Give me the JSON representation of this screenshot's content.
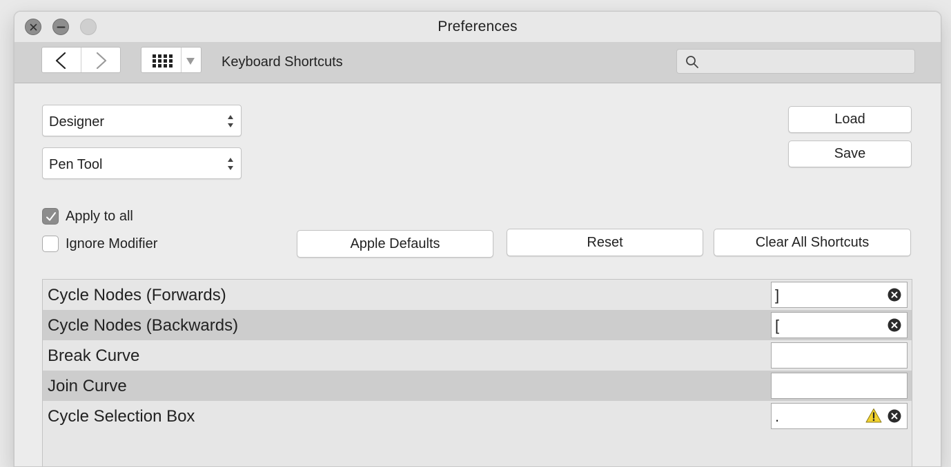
{
  "window": {
    "title": "Preferences"
  },
  "toolbar": {
    "label": "Keyboard Shortcuts",
    "search_placeholder": "",
    "search_value": ""
  },
  "selects": {
    "app": "Designer",
    "tool": "Pen Tool"
  },
  "buttons": {
    "load": "Load",
    "save": "Save",
    "apple_defaults": "Apple Defaults",
    "reset": "Reset",
    "clear_all": "Clear All Shortcuts"
  },
  "options": {
    "apply_to_all": {
      "label": "Apply to all",
      "checked": true
    },
    "ignore_modifier": {
      "label": "Ignore Modifier",
      "checked": false
    }
  },
  "shortcuts": [
    {
      "name": "Cycle Nodes (Forwards)",
      "key": "]",
      "warning": false,
      "clearable": true
    },
    {
      "name": "Cycle Nodes (Backwards)",
      "key": "[",
      "warning": false,
      "clearable": true
    },
    {
      "name": "Break Curve",
      "key": "",
      "warning": false,
      "clearable": false
    },
    {
      "name": "Join Curve",
      "key": "",
      "warning": false,
      "clearable": false
    },
    {
      "name": "Cycle Selection Box",
      "key": ".",
      "warning": true,
      "clearable": true
    }
  ],
  "icons": {
    "close": "close-icon",
    "minimize": "minimize-icon",
    "zoom": "zoom-icon",
    "back": "chevron-left-icon",
    "forward": "chevron-right-icon",
    "grid": "grid-icon",
    "dropdown": "caret-down-icon",
    "search": "search-icon",
    "clear": "clear-circle-icon",
    "warning": "warning-triangle-icon"
  },
  "colors": {
    "toolbar_bg": "#d1d1d1",
    "row_light": "#e6e6e6",
    "row_dark": "#cdcdcd",
    "checkbox_on": "#8c8c8c",
    "warning": "#f2d22e"
  }
}
